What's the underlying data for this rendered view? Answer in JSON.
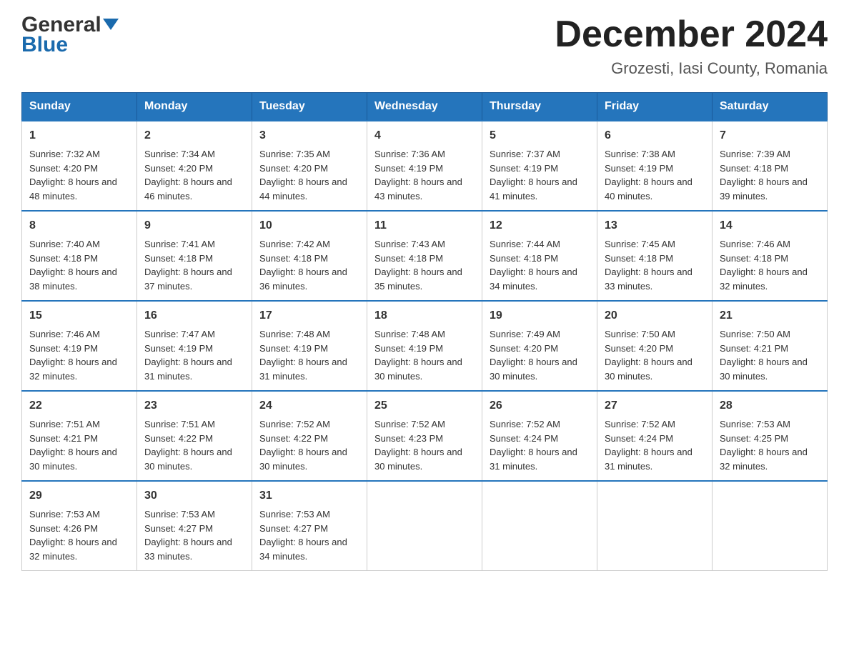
{
  "header": {
    "logo_general": "General",
    "logo_blue": "Blue",
    "calendar_title": "December 2024",
    "calendar_subtitle": "Grozesti, Iasi County, Romania"
  },
  "days_of_week": [
    "Sunday",
    "Monday",
    "Tuesday",
    "Wednesday",
    "Thursday",
    "Friday",
    "Saturday"
  ],
  "weeks": [
    [
      {
        "day": "1",
        "sunrise": "7:32 AM",
        "sunset": "4:20 PM",
        "daylight": "8 hours and 48 minutes."
      },
      {
        "day": "2",
        "sunrise": "7:34 AM",
        "sunset": "4:20 PM",
        "daylight": "8 hours and 46 minutes."
      },
      {
        "day": "3",
        "sunrise": "7:35 AM",
        "sunset": "4:20 PM",
        "daylight": "8 hours and 44 minutes."
      },
      {
        "day": "4",
        "sunrise": "7:36 AM",
        "sunset": "4:19 PM",
        "daylight": "8 hours and 43 minutes."
      },
      {
        "day": "5",
        "sunrise": "7:37 AM",
        "sunset": "4:19 PM",
        "daylight": "8 hours and 41 minutes."
      },
      {
        "day": "6",
        "sunrise": "7:38 AM",
        "sunset": "4:19 PM",
        "daylight": "8 hours and 40 minutes."
      },
      {
        "day": "7",
        "sunrise": "7:39 AM",
        "sunset": "4:18 PM",
        "daylight": "8 hours and 39 minutes."
      }
    ],
    [
      {
        "day": "8",
        "sunrise": "7:40 AM",
        "sunset": "4:18 PM",
        "daylight": "8 hours and 38 minutes."
      },
      {
        "day": "9",
        "sunrise": "7:41 AM",
        "sunset": "4:18 PM",
        "daylight": "8 hours and 37 minutes."
      },
      {
        "day": "10",
        "sunrise": "7:42 AM",
        "sunset": "4:18 PM",
        "daylight": "8 hours and 36 minutes."
      },
      {
        "day": "11",
        "sunrise": "7:43 AM",
        "sunset": "4:18 PM",
        "daylight": "8 hours and 35 minutes."
      },
      {
        "day": "12",
        "sunrise": "7:44 AM",
        "sunset": "4:18 PM",
        "daylight": "8 hours and 34 minutes."
      },
      {
        "day": "13",
        "sunrise": "7:45 AM",
        "sunset": "4:18 PM",
        "daylight": "8 hours and 33 minutes."
      },
      {
        "day": "14",
        "sunrise": "7:46 AM",
        "sunset": "4:18 PM",
        "daylight": "8 hours and 32 minutes."
      }
    ],
    [
      {
        "day": "15",
        "sunrise": "7:46 AM",
        "sunset": "4:19 PM",
        "daylight": "8 hours and 32 minutes."
      },
      {
        "day": "16",
        "sunrise": "7:47 AM",
        "sunset": "4:19 PM",
        "daylight": "8 hours and 31 minutes."
      },
      {
        "day": "17",
        "sunrise": "7:48 AM",
        "sunset": "4:19 PM",
        "daylight": "8 hours and 31 minutes."
      },
      {
        "day": "18",
        "sunrise": "7:48 AM",
        "sunset": "4:19 PM",
        "daylight": "8 hours and 30 minutes."
      },
      {
        "day": "19",
        "sunrise": "7:49 AM",
        "sunset": "4:20 PM",
        "daylight": "8 hours and 30 minutes."
      },
      {
        "day": "20",
        "sunrise": "7:50 AM",
        "sunset": "4:20 PM",
        "daylight": "8 hours and 30 minutes."
      },
      {
        "day": "21",
        "sunrise": "7:50 AM",
        "sunset": "4:21 PM",
        "daylight": "8 hours and 30 minutes."
      }
    ],
    [
      {
        "day": "22",
        "sunrise": "7:51 AM",
        "sunset": "4:21 PM",
        "daylight": "8 hours and 30 minutes."
      },
      {
        "day": "23",
        "sunrise": "7:51 AM",
        "sunset": "4:22 PM",
        "daylight": "8 hours and 30 minutes."
      },
      {
        "day": "24",
        "sunrise": "7:52 AM",
        "sunset": "4:22 PM",
        "daylight": "8 hours and 30 minutes."
      },
      {
        "day": "25",
        "sunrise": "7:52 AM",
        "sunset": "4:23 PM",
        "daylight": "8 hours and 30 minutes."
      },
      {
        "day": "26",
        "sunrise": "7:52 AM",
        "sunset": "4:24 PM",
        "daylight": "8 hours and 31 minutes."
      },
      {
        "day": "27",
        "sunrise": "7:52 AM",
        "sunset": "4:24 PM",
        "daylight": "8 hours and 31 minutes."
      },
      {
        "day": "28",
        "sunrise": "7:53 AM",
        "sunset": "4:25 PM",
        "daylight": "8 hours and 32 minutes."
      }
    ],
    [
      {
        "day": "29",
        "sunrise": "7:53 AM",
        "sunset": "4:26 PM",
        "daylight": "8 hours and 32 minutes."
      },
      {
        "day": "30",
        "sunrise": "7:53 AM",
        "sunset": "4:27 PM",
        "daylight": "8 hours and 33 minutes."
      },
      {
        "day": "31",
        "sunrise": "7:53 AM",
        "sunset": "4:27 PM",
        "daylight": "8 hours and 34 minutes."
      },
      null,
      null,
      null,
      null
    ]
  ]
}
